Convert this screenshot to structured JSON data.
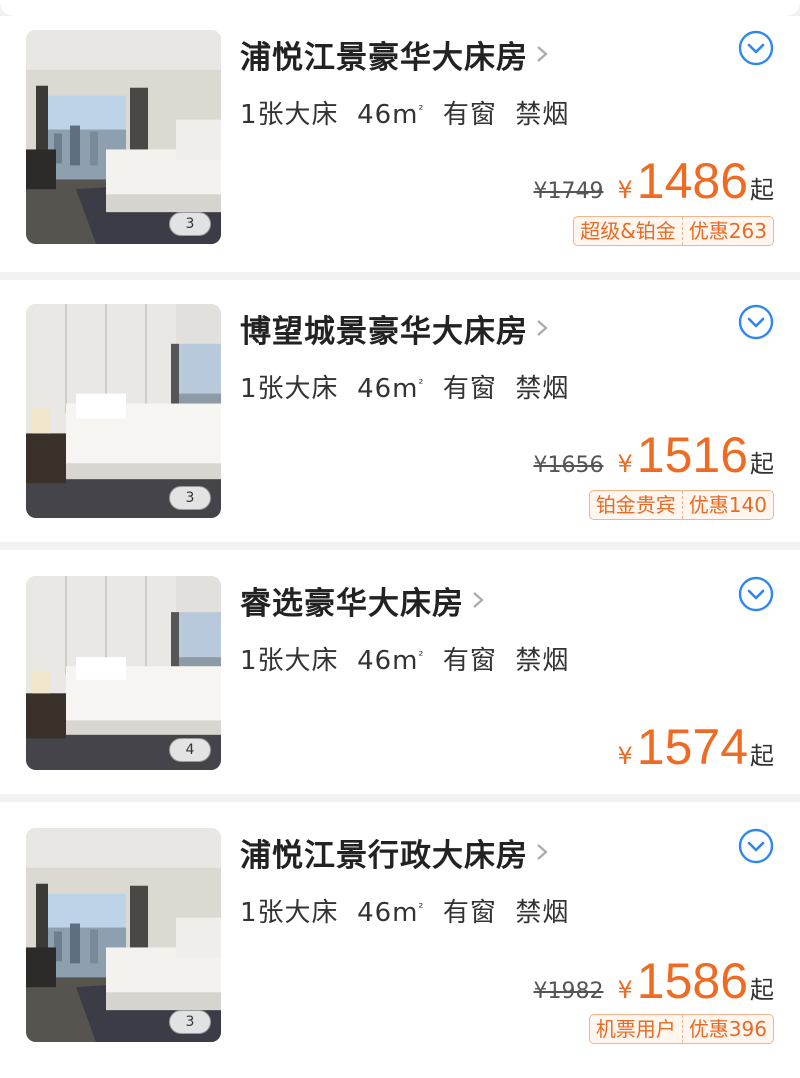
{
  "colors": {
    "accent": "#ee6b21",
    "link_blue": "#2f86f0"
  },
  "rooms": [
    {
      "name": "浦悦江景豪华大床房",
      "bed": "1张大床",
      "area": "46m",
      "area_unit": "²",
      "window": "有窗",
      "smoking": "禁烟",
      "photo_count": "3",
      "original_price": "¥1749",
      "currency": "¥",
      "price": "1486",
      "price_suffix": "起",
      "badges": [
        "超级&铂金",
        "优惠263"
      ]
    },
    {
      "name": "博望城景豪华大床房",
      "bed": "1张大床",
      "area": "46m",
      "area_unit": "²",
      "window": "有窗",
      "smoking": "禁烟",
      "photo_count": "3",
      "original_price": "¥1656",
      "currency": "¥",
      "price": "1516",
      "price_suffix": "起",
      "badges": [
        "铂金贵宾",
        "优惠140"
      ]
    },
    {
      "name": "睿选豪华大床房",
      "bed": "1张大床",
      "area": "46m",
      "area_unit": "²",
      "window": "有窗",
      "smoking": "禁烟",
      "photo_count": "4",
      "currency": "¥",
      "price": "1574",
      "price_suffix": "起"
    },
    {
      "name": "浦悦江景行政大床房",
      "bed": "1张大床",
      "area": "46m",
      "area_unit": "²",
      "window": "有窗",
      "smoking": "禁烟",
      "photo_count": "3",
      "original_price": "¥1982",
      "currency": "¥",
      "price": "1586",
      "price_suffix": "起",
      "badges": [
        "机票用户",
        "优惠396"
      ]
    }
  ]
}
